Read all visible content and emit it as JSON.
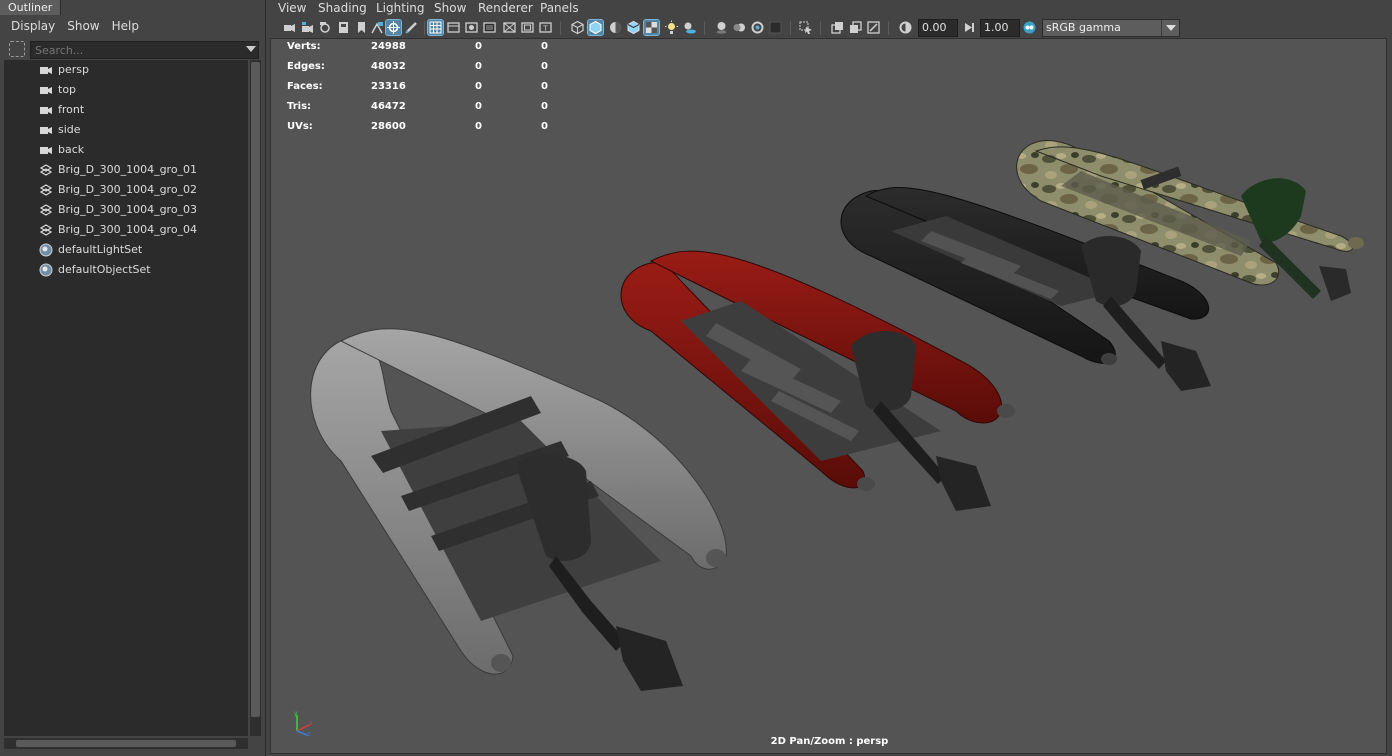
{
  "outliner": {
    "tab_label": "Outliner",
    "menu": [
      "Display",
      "Show",
      "Help"
    ],
    "search_placeholder": "Search...",
    "items": [
      {
        "label": "persp",
        "icon": "camera-icon"
      },
      {
        "label": "top",
        "icon": "camera-icon"
      },
      {
        "label": "front",
        "icon": "camera-icon"
      },
      {
        "label": "side",
        "icon": "camera-icon"
      },
      {
        "label": "back",
        "icon": "camera-icon"
      },
      {
        "label": "Brig_D_300_1004_gro_01",
        "icon": "group-transform-icon"
      },
      {
        "label": "Brig_D_300_1004_gro_02",
        "icon": "group-transform-icon"
      },
      {
        "label": "Brig_D_300_1004_gro_03",
        "icon": "group-transform-icon"
      },
      {
        "label": "Brig_D_300_1004_gro_04",
        "icon": "group-transform-icon"
      },
      {
        "label": "defaultLightSet",
        "icon": "set-icon"
      },
      {
        "label": "defaultObjectSet",
        "icon": "set-icon"
      }
    ]
  },
  "viewport": {
    "menu": [
      "View",
      "Shading",
      "Lighting",
      "Show",
      "Renderer",
      "Panels"
    ],
    "exposure_value": "0.00",
    "gamma_value": "1.00",
    "color_space": "sRGB gamma",
    "camera_label": "2D Pan/Zoom : persp",
    "hud": [
      {
        "label": "Verts:",
        "v1": "24988",
        "v2": "0",
        "v3": "0"
      },
      {
        "label": "Edges:",
        "v1": "48032",
        "v2": "0",
        "v3": "0"
      },
      {
        "label": "Faces:",
        "v1": "23316",
        "v2": "0",
        "v3": "0"
      },
      {
        "label": "Tris:",
        "v1": "46472",
        "v2": "0",
        "v3": "0"
      },
      {
        "label": "UVs:",
        "v1": "28600",
        "v2": "0",
        "v3": "0"
      }
    ],
    "boats": [
      {
        "name": "white-inflatable-boat",
        "color": "#8a8a8a"
      },
      {
        "name": "red-inflatable-boat",
        "color": "#7a1410"
      },
      {
        "name": "black-inflatable-boat",
        "color": "#1c1c1c"
      },
      {
        "name": "camo-inflatable-boat",
        "color": "#7e8463"
      }
    ]
  },
  "colors": {
    "panel_bg": "#444444",
    "viewport_bg": "#545454",
    "field_bg": "#2b2b2b",
    "active_tool": "#5285a6"
  }
}
